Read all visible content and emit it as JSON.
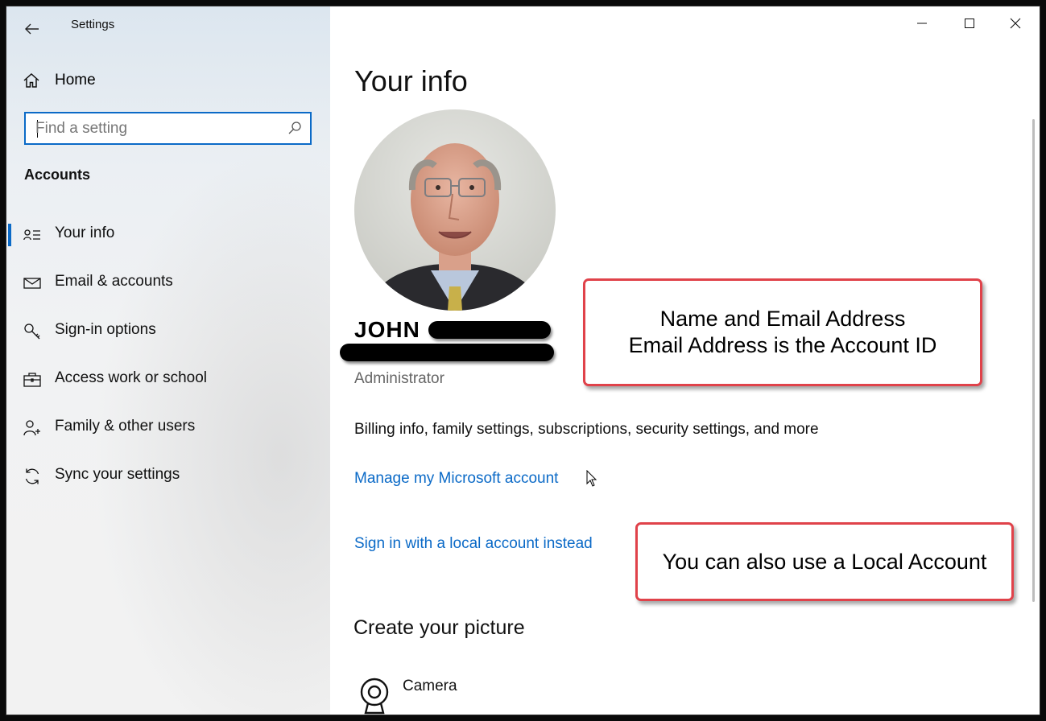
{
  "window": {
    "title": "Settings"
  },
  "sidebar": {
    "home_label": "Home",
    "search_placeholder": "Find a setting",
    "search_value": "",
    "section_title": "Accounts",
    "items": [
      {
        "label": "Your info",
        "icon": "person-list-icon",
        "active": true
      },
      {
        "label": "Email & accounts",
        "icon": "mail-icon",
        "active": false
      },
      {
        "label": "Sign-in options",
        "icon": "key-icon",
        "active": false
      },
      {
        "label": "Access work or school",
        "icon": "briefcase-icon",
        "active": false
      },
      {
        "label": "Family & other users",
        "icon": "person-add-icon",
        "active": false
      },
      {
        "label": "Sync your settings",
        "icon": "sync-icon",
        "active": false
      }
    ]
  },
  "main": {
    "page_title": "Your info",
    "user_name": "JOHN",
    "role": "Administrator",
    "billing_text": "Billing info, family settings, subscriptions, security settings, and more",
    "manage_link": "Manage my Microsoft account",
    "local_link": "Sign in with a local account instead",
    "create_picture_heading": "Create your picture",
    "camera_label": "Camera"
  },
  "callouts": {
    "account_id_line1": "Name and Email Address",
    "account_id_line2": "Email Address is the Account ID",
    "local_account": "You can also use a Local Account"
  },
  "colors": {
    "accent": "#0b6ac7",
    "callout_border": "#e0424a"
  }
}
